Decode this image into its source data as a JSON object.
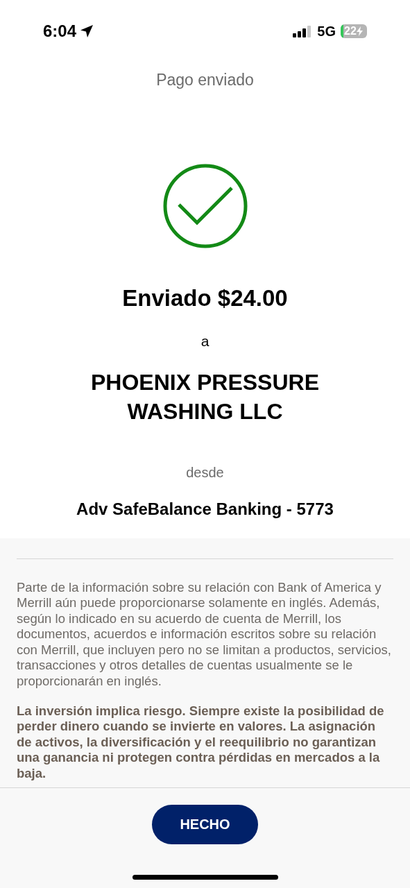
{
  "status_bar": {
    "time": "6:04",
    "network": "5G",
    "battery": "22"
  },
  "title": "Pago enviado",
  "amount_line": "Enviado $24.00",
  "to_label": "a",
  "recipient": "PHOENIX PRESSURE WASHING LLC",
  "from_label": "desde",
  "account": "Adv SafeBalance Banking - 5773",
  "disclosures": [
    {
      "text": "Parte de la información sobre su relación con Bank of America y Merrill aún puede proporcionarse solamente en inglés. Además, según lo indicado en su acuerdo de cuenta de Merrill, los documentos, acuerdos e información escritos sobre su relación con Merrill, que incluyen pero no se limitan a productos, servicios, transacciones y otros detalles de cuentas usualmente se le proporcionarán en inglés.",
      "bold": false
    },
    {
      "text": "La inversión implica riesgo. Siempre existe la posibilidad de perder dinero cuando se invierte en valores. La asignación de activos, la diversificación y el reequilibrio no garantizan una ganancia ni protegen contra pérdidas en mercados a la baja.",
      "bold": true
    }
  ],
  "done_button": "HECHO"
}
